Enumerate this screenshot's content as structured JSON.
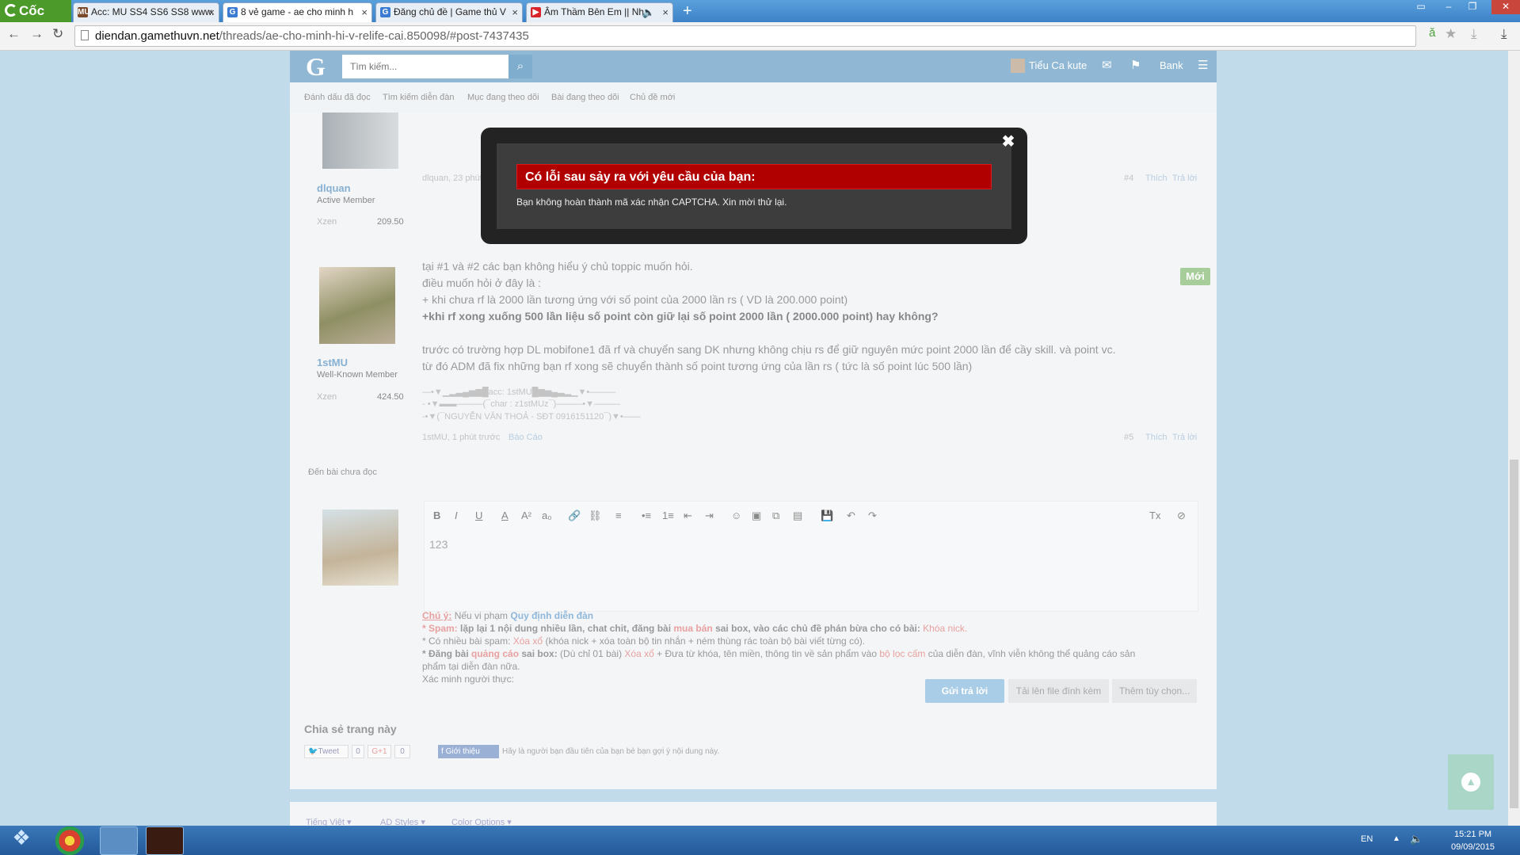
{
  "browser": {
    "brand": "Cốc Cốc",
    "tabs": [
      {
        "title": "Acc: MU SS4 SS6 SS8 www.",
        "favicon": "MU",
        "color": "#7b4a2a"
      },
      {
        "title": "8 vẻ game - ae cho minh h",
        "favicon": "G",
        "color": "#3b7bd3"
      },
      {
        "title": "Đăng chủ đề | Game thủ V",
        "favicon": "G",
        "color": "#3b7bd3"
      },
      {
        "title": "Âm Thầm Bên Em || Nh",
        "favicon": "▶",
        "color": "#d9232a"
      }
    ],
    "url_domain": "diendan.gamethuvn.net",
    "url_path": "/threads/ae-cho-minh-hi-v-relife-cai.850098/#post-7437435"
  },
  "forum": {
    "logo": "G",
    "search_placeholder": "Tìm kiếm...",
    "user": "Tiểu Ca kute",
    "bank": "Bank",
    "subnav": [
      "Đánh dấu đã đọc",
      "Tìm kiếm diễn đàn",
      "Mục đang theo dõi",
      "Bài đang theo dõi",
      "Chủ đề mới"
    ]
  },
  "posts": [
    {
      "username": "dlquan",
      "title": "Active Member",
      "stat_label": "Xzen",
      "stat_value": "209.50",
      "meta": "dlquan, 23 phút",
      "number": "#4",
      "like": "Thích",
      "reply": "Trả lời"
    },
    {
      "username": "1stMU",
      "title": "Well-Known Member",
      "stat_label": "Xzen",
      "stat_value": "424.50",
      "lines": [
        "tại #1 và #2 các bạn không hiểu ý chủ toppic muốn hỏi.",
        "điều muốn hỏi ở đây là :",
        "+ khi chưa rf là 2000 lần tương ứng với số point của 2000 lần rs ( VD là 200.000 point)",
        "+khi rf xong xuống 500 lần liệu số point còn giữ lại số point 2000 lần ( 2000.000 point) hay không?",
        "trước có trường hợp DL mobifone1 đã rf và chuyển sang DK nhưng không chịu rs để giữ nguyên mức point 2000 lần để cầy skill. và point vc.",
        "từ đó ADM đã fix những bạn rf xong sẽ chuyển thành số point tương ứng của lần rs ( tức là số point lúc 500 lần)"
      ],
      "sig": [
        "—•▼▁▂▃▄▅▆█acc: 1stMU█▆▅▄▃▂▁▼•———",
        "- •▼▬▬———(¯char : z1stMUz¯)———•▼———",
        "-•▼(¯NGUYỄN VĂN THOẢ - SĐT 0916151120¯)▼•——"
      ],
      "meta": "1stMU, 1 phút trước",
      "report": "Báo Cáo",
      "number": "#5",
      "like": "Thích",
      "reply": "Trả lời",
      "badge": "Mới"
    }
  ],
  "unread": "Đến bài chưa đọc",
  "editor": {
    "toolbar": [
      "B",
      "I",
      "U",
      "A",
      "A²",
      "a₀",
      "🔗",
      "⛓",
      "≡",
      "•≡",
      "1≡",
      "⇤",
      "⇥",
      "☺",
      "▣",
      "⧉",
      "▤",
      "💾",
      "↶",
      "↷"
    ],
    "tool_right": [
      "Tx",
      "⊘"
    ],
    "value": "123"
  },
  "rules": {
    "label": "Chú ý:",
    "intro": "Nếu vi phạm",
    "link": "Quy định diễn đàn",
    "r1_a": "* Spam:",
    "r1_b": " lặp lại 1 nội dung nhiều lần, chat chit, đăng bài",
    "r1_c": " mua bán",
    "r1_d": " sai box, vào các chủ đề phán bừa cho có bài:",
    "r1_e": " Khóa nick.",
    "r2_a": "* Có nhiều bài spam:",
    "r2_b": " Xóa xổ",
    "r2_c": " (khóa nick + xóa toàn bộ tin nhắn + ném thùng rác toàn bộ bài viết từng có).",
    "r3_a": "* Đăng bài",
    "r3_b": " quảng cáo",
    "r3_c": " sai box:",
    "r3_d": " (Dù chỉ 01 bài)",
    "r3_e": " Xóa xổ",
    "r3_f": " + Đưa từ khóa, tên miền, thông tin về sản phẩm vào",
    "r3_g": " bộ lọc cấm",
    "r3_h": " của diễn đàn, vĩnh viễn không thể quảng cáo sản",
    "r3_i": "phẩm tại diễn đàn nữa.",
    "captcha": "Xác minh người thực:"
  },
  "buttons": {
    "send": "Gửi trả lời",
    "attach": "Tải lên file đính kèm",
    "more": "Thêm tùy chọn..."
  },
  "share": {
    "title": "Chia sẻ trang này",
    "tweet": "Tweet",
    "tweet_count": "0",
    "gplus": "G+1",
    "gplus_count": "0",
    "fb": "Giới thiệu",
    "fb_text": "Hãy là người bạn đầu tiên của bạn bè bạn gợi ý nội dung này."
  },
  "footer": [
    "Tiếng Việt ▾",
    "AD Styles ▾",
    "Color Options ▾"
  ],
  "modal": {
    "title": "Có lỗi sau sảy ra với yêu cầu của bạn:",
    "message": "Bạn không hoàn thành mã xác nhận CAPTCHA. Xin mời thử lại."
  },
  "taskbar": {
    "lang": "EN",
    "time": "15:21 PM",
    "date": "09/09/2015"
  }
}
